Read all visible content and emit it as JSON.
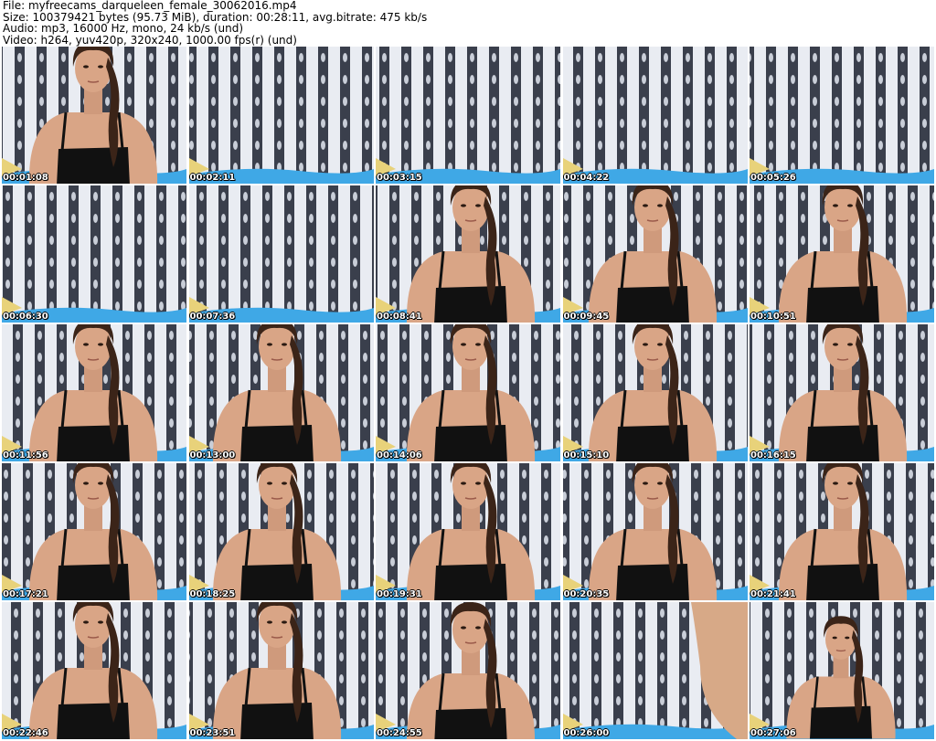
{
  "header": {
    "file_line": "File: myfreecams_darqueleen_female_30062016.mp4",
    "size_line": "Size: 100379421 bytes (95.73 MiB), duration: 00:28:11, avg.bitrate: 475 kb/s",
    "audio_line": "Audio: mp3, 16000 Hz, mono, 24 kb/s (und)",
    "video_line": "Video: h264, yuv420p, 320x240, 1000.00 fps(r) (und)"
  },
  "thumbnails": [
    {
      "timestamp": "00:01:08",
      "scene": "person"
    },
    {
      "timestamp": "00:02:11",
      "scene": "empty"
    },
    {
      "timestamp": "00:03:15",
      "scene": "empty"
    },
    {
      "timestamp": "00:04:22",
      "scene": "empty"
    },
    {
      "timestamp": "00:05:26",
      "scene": "empty"
    },
    {
      "timestamp": "00:06:30",
      "scene": "empty"
    },
    {
      "timestamp": "00:07:36",
      "scene": "empty"
    },
    {
      "timestamp": "00:08:41",
      "scene": "person"
    },
    {
      "timestamp": "00:09:45",
      "scene": "person"
    },
    {
      "timestamp": "00:10:51",
      "scene": "person"
    },
    {
      "timestamp": "00:11:56",
      "scene": "person"
    },
    {
      "timestamp": "00:13:00",
      "scene": "person"
    },
    {
      "timestamp": "00:14:06",
      "scene": "person"
    },
    {
      "timestamp": "00:15:10",
      "scene": "person"
    },
    {
      "timestamp": "00:16:15",
      "scene": "person"
    },
    {
      "timestamp": "00:17:21",
      "scene": "person"
    },
    {
      "timestamp": "00:18:25",
      "scene": "person"
    },
    {
      "timestamp": "00:19:31",
      "scene": "person"
    },
    {
      "timestamp": "00:20:35",
      "scene": "person"
    },
    {
      "timestamp": "00:21:41",
      "scene": "person"
    },
    {
      "timestamp": "00:22:46",
      "scene": "person"
    },
    {
      "timestamp": "00:23:51",
      "scene": "person"
    },
    {
      "timestamp": "00:24:55",
      "scene": "person-looking-down"
    },
    {
      "timestamp": "00:26:00",
      "scene": "close-up-blur"
    },
    {
      "timestamp": "00:27:06",
      "scene": "person-far"
    }
  ],
  "colors": {
    "wall_light": "#e9ecf2",
    "wall_stripe": "#3a3f4c",
    "bed_blue": "#3fa8e6",
    "skin": "#d9a586",
    "hair": "#3b2418",
    "top_black": "#111111"
  }
}
